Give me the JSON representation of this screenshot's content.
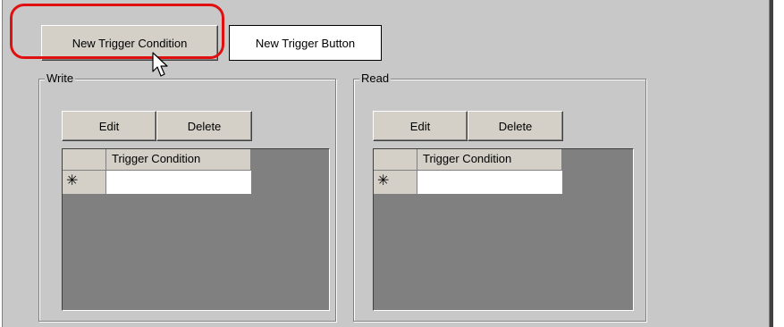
{
  "toolbar": {
    "new_trigger_condition": "New Trigger Condition",
    "new_trigger_button": "New Trigger Button"
  },
  "write_group": {
    "title": "Write",
    "edit_label": "Edit",
    "delete_label": "Delete",
    "grid": {
      "column_header": "Trigger Condition",
      "new_row_marker": "✳",
      "rows": [
        ""
      ]
    }
  },
  "read_group": {
    "title": "Read",
    "edit_label": "Edit",
    "delete_label": "Delete",
    "grid": {
      "column_header": "Trigger Condition",
      "new_row_marker": "✳",
      "rows": [
        ""
      ]
    }
  },
  "colors": {
    "panel": "#c8c8c8",
    "highlight": "#e01010",
    "grid_bg": "#808080"
  }
}
